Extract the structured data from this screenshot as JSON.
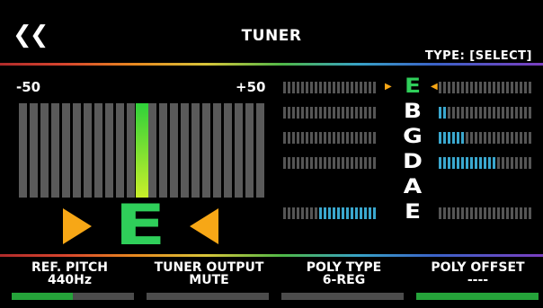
{
  "header": {
    "title": "TUNER",
    "type_label": "TYPE: [SELECT]"
  },
  "meter": {
    "min_label": "-50",
    "max_label": "+50",
    "cents": 0,
    "range": [
      -50,
      50
    ]
  },
  "note": "E",
  "strings": [
    {
      "note": "E",
      "active": true,
      "deviation": 0
    },
    {
      "note": "B",
      "active": false,
      "deviation": 0.08
    },
    {
      "note": "G",
      "active": false,
      "deviation": 0.28
    },
    {
      "note": "D",
      "active": false,
      "deviation": 0.62
    },
    {
      "note": "A",
      "active": false,
      "deviation": null
    },
    {
      "note": "E",
      "active": false,
      "deviation": -0.62
    }
  ],
  "params": [
    {
      "label": "REF. PITCH",
      "value": "440Hz",
      "level": 0.5
    },
    {
      "label": "TUNER OUTPUT",
      "value": "MUTE",
      "level": 0
    },
    {
      "label": "POLY TYPE",
      "value": "6-REG",
      "level": 0
    },
    {
      "label": "POLY OFFSET",
      "value": "----",
      "level": 1.0
    }
  ],
  "colors": {
    "accent": "#2fcf5a",
    "indicator": "#f7a716",
    "bar": "#25a33a",
    "string_level": "#3aa8cf"
  },
  "icons": {
    "back": "double-chevron-left-icon"
  }
}
